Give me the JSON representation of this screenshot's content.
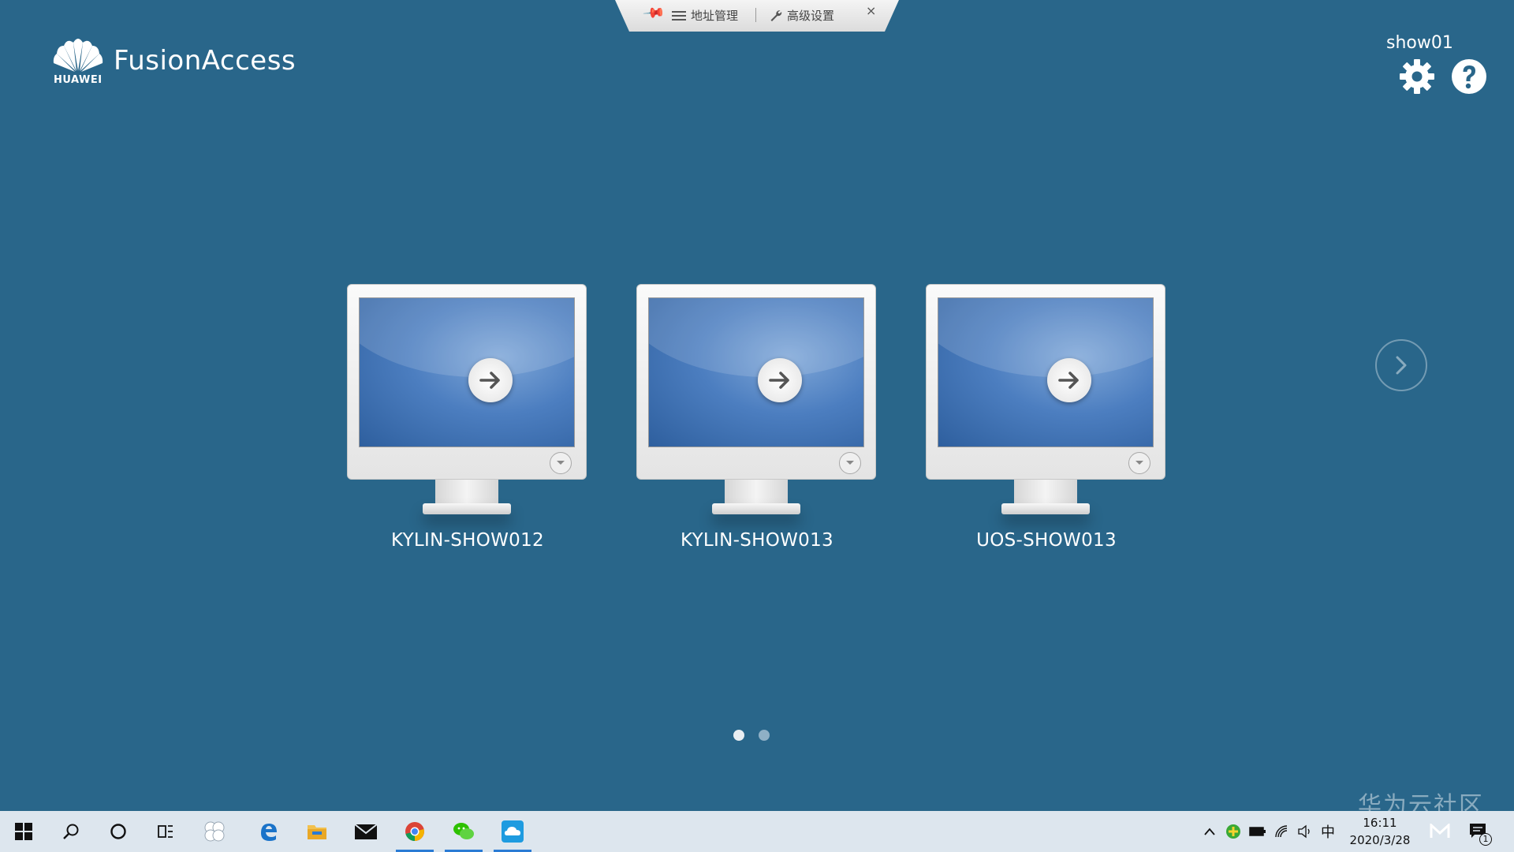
{
  "toolbar": {
    "address_manage_label": "地址管理",
    "advanced_settings_label": "高级设置",
    "close_label": "×"
  },
  "header": {
    "app_name": "FusionAccess",
    "brand_name": "HUAWEI",
    "username": "show01"
  },
  "desktops": [
    {
      "name": "KYLIN-SHOW012"
    },
    {
      "name": "KYLIN-SHOW013"
    },
    {
      "name": "UOS-SHOW013"
    }
  ],
  "pagination": {
    "current": 1,
    "total": 2
  },
  "watermark": "华为云社区",
  "taskbar": {
    "ime_label": "中",
    "time": "16:11",
    "date": "2020/3/28",
    "notification_count": "1"
  },
  "colors": {
    "background": "#29668a",
    "taskbar": "#dde6ee",
    "accent": "#2a7bd4"
  }
}
